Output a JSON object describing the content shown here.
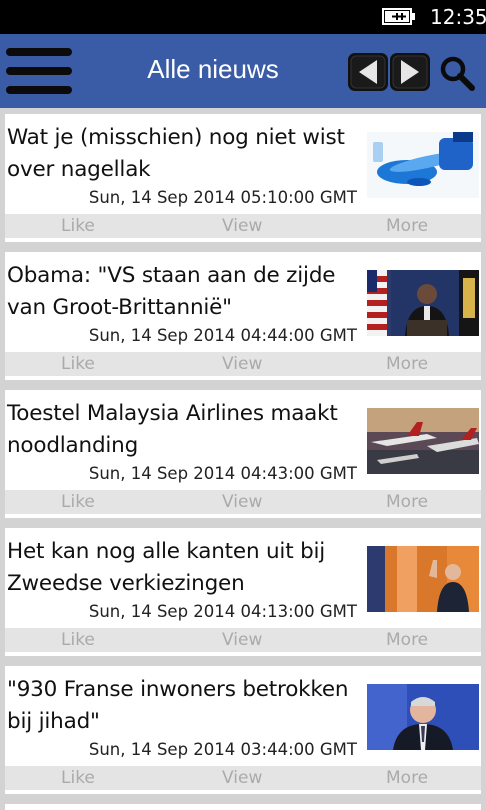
{
  "status": {
    "time": "12:35",
    "battery_icon": "battery-charging-icon"
  },
  "header": {
    "title": "Alle nieuws",
    "bg_color": "#3a5ba6",
    "icons": [
      "hamburger-menu-icon",
      "arrow-left-icon",
      "arrow-right-icon",
      "search-icon"
    ]
  },
  "articles": [
    {
      "title": "Wat je (misschien) nog niet wist over nagellak",
      "date": "Sun, 14 Sep 2014 05:10:00 GMT",
      "thumb": "nail-polish-photo",
      "actions": {
        "like": "Like",
        "view": "View",
        "more": "More"
      }
    },
    {
      "title": "Obama: \"VS staan aan de zijde van Groot-Brittannië\"",
      "date": "Sun, 14 Sep 2014 04:44:00 GMT",
      "thumb": "obama-podium-photo",
      "actions": {
        "like": "Like",
        "view": "View",
        "more": "More"
      }
    },
    {
      "title": "Toestel Malaysia Airlines maakt noodlanding",
      "date": "Sun, 14 Sep 2014 04:43:00 GMT",
      "thumb": "aircraft-photo",
      "actions": {
        "like": "Like",
        "view": "View",
        "more": "More"
      }
    },
    {
      "title": "Het kan nog alle kanten uit bij Zweedse verkiezingen",
      "date": "Sun, 14 Sep 2014 04:13:00 GMT",
      "thumb": "election-photo",
      "actions": {
        "like": "Like",
        "view": "View",
        "more": "More"
      }
    },
    {
      "title": "\"930 Franse inwoners betrokken bij jihad\"",
      "date": "Sun, 14 Sep 2014 03:44:00 GMT",
      "thumb": "politician-photo",
      "actions": {
        "like": "Like",
        "view": "View",
        "more": "More"
      }
    }
  ]
}
